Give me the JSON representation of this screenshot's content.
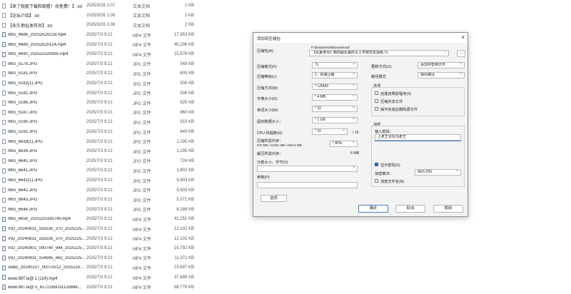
{
  "file_list": [
    {
      "name": "【来了就能下载和观看！尚免费！】.txt",
      "date": "2025/3/26 1:07",
      "type": "文本文档",
      "size": "2 KB",
      "kind": "txt"
    },
    {
      "name": "【论坛介绍】.txt",
      "date": "2025/3/26 1:08",
      "type": "文本文档",
      "size": "2 KB",
      "kind": "txt"
    },
    {
      "name": "【永久地址发布页】.txt",
      "date": "2025/3/26 1:08",
      "type": "文本文档",
      "size": "2 KB",
      "kind": "txt"
    },
    {
      "name": "IMG_4686_20252520228.mp4",
      "date": "2025/7/3 9:21",
      "type": "MP4 文件",
      "size": "17,953 KB",
      "kind": "mp4"
    },
    {
      "name": "IMG_4689_20252520124.mp4",
      "date": "2025/7/3 9:21",
      "type": "MP4 文件",
      "size": "40,296 KB",
      "kind": "mp4"
    },
    {
      "name": "IMG_4690_202522520855.mp4",
      "date": "2025/7/3 9:21",
      "type": "MP4 文件",
      "size": "15,876 KB",
      "kind": "mp4"
    },
    {
      "name": "IMG_5178.JPG",
      "date": "2025/7/3 9:21",
      "type": "JPG 文件",
      "size": "548 KB",
      "kind": "jpg"
    },
    {
      "name": "IMG_5181.JPG",
      "date": "2025/7/3 9:21",
      "type": "JPG 文件",
      "size": "605 KB",
      "kind": "jpg"
    },
    {
      "name": "IMG_5182(1).JPG",
      "date": "2025/7/3 9:21",
      "type": "JPG 文件",
      "size": "506 KB",
      "kind": "jpg"
    },
    {
      "name": "IMG_5182.JPG",
      "date": "2025/7/3 9:21",
      "type": "JPG 文件",
      "size": "506 KB",
      "kind": "jpg"
    },
    {
      "name": "IMG_5186.JPG",
      "date": "2025/7/3 9:21",
      "type": "JPG 文件",
      "size": "825 KB",
      "kind": "jpg"
    },
    {
      "name": "IMG_5187.JPG",
      "date": "2025/7/3 9:21",
      "type": "JPG 文件",
      "size": "960 KB",
      "kind": "jpg"
    },
    {
      "name": "IMG_5190.JPG",
      "date": "2025/7/3 9:21",
      "type": "JPG 文件",
      "size": "919 KB",
      "kind": "jpg"
    },
    {
      "name": "IMG_5192.JPG",
      "date": "2025/7/3 9:21",
      "type": "JPG 文件",
      "size": "649 KB",
      "kind": "jpg"
    },
    {
      "name": "IMG_6639(1).JPG",
      "date": "2025/7/3 9:21",
      "type": "JPG 文件",
      "size": "1,295 KB",
      "kind": "jpg"
    },
    {
      "name": "IMG_6639.JPG",
      "date": "2025/7/3 9:21",
      "type": "JPG 文件",
      "size": "1,295 KB",
      "kind": "jpg"
    },
    {
      "name": "IMG_6640.JPG",
      "date": "2025/7/3 9:21",
      "type": "JPG 文件",
      "size": "724 KB",
      "kind": "jpg"
    },
    {
      "name": "IMG_6641.JPG",
      "date": "2025/7/3 9:21",
      "type": "JPG 文件",
      "size": "1,802 KB",
      "kind": "jpg"
    },
    {
      "name": "IMG_6642(1).JPG",
      "date": "2025/7/3 9:21",
      "type": "JPG 文件",
      "size": "5,603 KB",
      "kind": "jpg"
    },
    {
      "name": "IMG_6642.JPG",
      "date": "2025/7/3 9:21",
      "type": "JPG 文件",
      "size": "5,603 KB",
      "kind": "jpg"
    },
    {
      "name": "IMG_6643.JPG",
      "date": "2025/7/3 9:21",
      "type": "JPG 文件",
      "size": "5,071 KB",
      "kind": "jpg"
    },
    {
      "name": "IMG_6644.JPG",
      "date": "2025/7/3 9:21",
      "type": "JPG 文件",
      "size": "6,188 KB",
      "kind": "jpg"
    },
    {
      "name": "IMG_6658_2025225195749.mp4",
      "date": "2025/7/3 9:21",
      "type": "MP4 文件",
      "size": "41,251 KB",
      "kind": "mp4"
    },
    {
      "name": "VID_20240831_155535_370_2025225...",
      "date": "2025/7/3 9:21",
      "type": "MP4 文件",
      "size": "12,102 KB",
      "kind": "mp4"
    },
    {
      "name": "VID_20240831_155535_370_2025225...",
      "date": "2025/7/3 9:21",
      "type": "MP4 文件",
      "size": "12,102 KB",
      "kind": "mp4"
    },
    {
      "name": "VID_20240901_000740_944_2025225...",
      "date": "2025/7/3 9:21",
      "type": "MP4 文件",
      "size": "19,792 KB",
      "kind": "mp4"
    },
    {
      "name": "VID_20240901_154945_662_2025225...",
      "date": "2025/7/3 9:21",
      "type": "MP4 文件",
      "size": "11,372 KB",
      "kind": "mp4"
    },
    {
      "name": "video_20240207_00073512_2025225...",
      "date": "2025/7/3 9:21",
      "type": "MP4 文件",
      "size": "23,687 KB",
      "kind": "mp4"
    },
    {
      "name": "www.98T.la@１(114).mp4",
      "date": "2025/7/3 9:21",
      "type": "MP4 文件",
      "size": "37,888 KB",
      "kind": "mp4"
    },
    {
      "name": "www.98T.la@ 5_6172265031128848...",
      "date": "2025/7/3 9:21",
      "type": "MP4 文件",
      "size": "88,779 KB",
      "kind": "mp4"
    }
  ],
  "dialog": {
    "title": "添加到压缩包",
    "close": "×",
    "archive_label": "压缩包(A):",
    "archive_path": "F:\\BaiduNetdiskDownload\\",
    "archive_name": "【反差老师】韩鸡服反差的大三学妹性爱视频.7z",
    "browse": "...",
    "format_label": "压缩格式(F):",
    "format_value": "7z",
    "level_label": "压缩等级(L):",
    "level_value": "3 - 快速压缩",
    "method_label": "压缩方法(M):",
    "method_value": "* LZMA2",
    "dict_label": "字典大小(D):",
    "dict_value": "* 4 MB",
    "word_label": "单词大小(W):",
    "word_value": "* 32",
    "solid_label": "固实数据大小：",
    "solid_value": "* 1 GB",
    "cpu_label": "CPU 线程数(H):",
    "cpu_value": "* 16",
    "cpu_total": "/ 16",
    "mem_label": "压缩所需内存：",
    "mem_detail": "976 MB / 12491 MB / 15614 MB",
    "mem_percent": "* 80%",
    "decomp_label": "解压所需内存：",
    "decomp_value": "6 MB",
    "split_label": "分卷大小，字节(V):",
    "split_value": "",
    "params_label": "参数(P):",
    "params_value": "",
    "options_button": "选项",
    "update_label": "更新方式(U):",
    "update_value": "添加并替换文件",
    "pathmode_label": "路径模式",
    "pathmode_value": "相对路径",
    "opts_title": "选项",
    "opt_sfx": "创建自释放程序(X)",
    "opt_shared": "压缩共享文件",
    "opt_delete": "操作完成后删除源文件",
    "enc_title": "加密",
    "enc_pw_label": "输入密码：",
    "enc_pw_value": "上老王论坛当老王",
    "show_pw": "显示密码(S)",
    "enc_method_label": "加密算法：",
    "enc_method_value": "AES-256",
    "enc_names": "加密文件名(N)",
    "ok": "确定",
    "cancel": "取消",
    "help": "帮助",
    "accent": "#2a62b8"
  }
}
